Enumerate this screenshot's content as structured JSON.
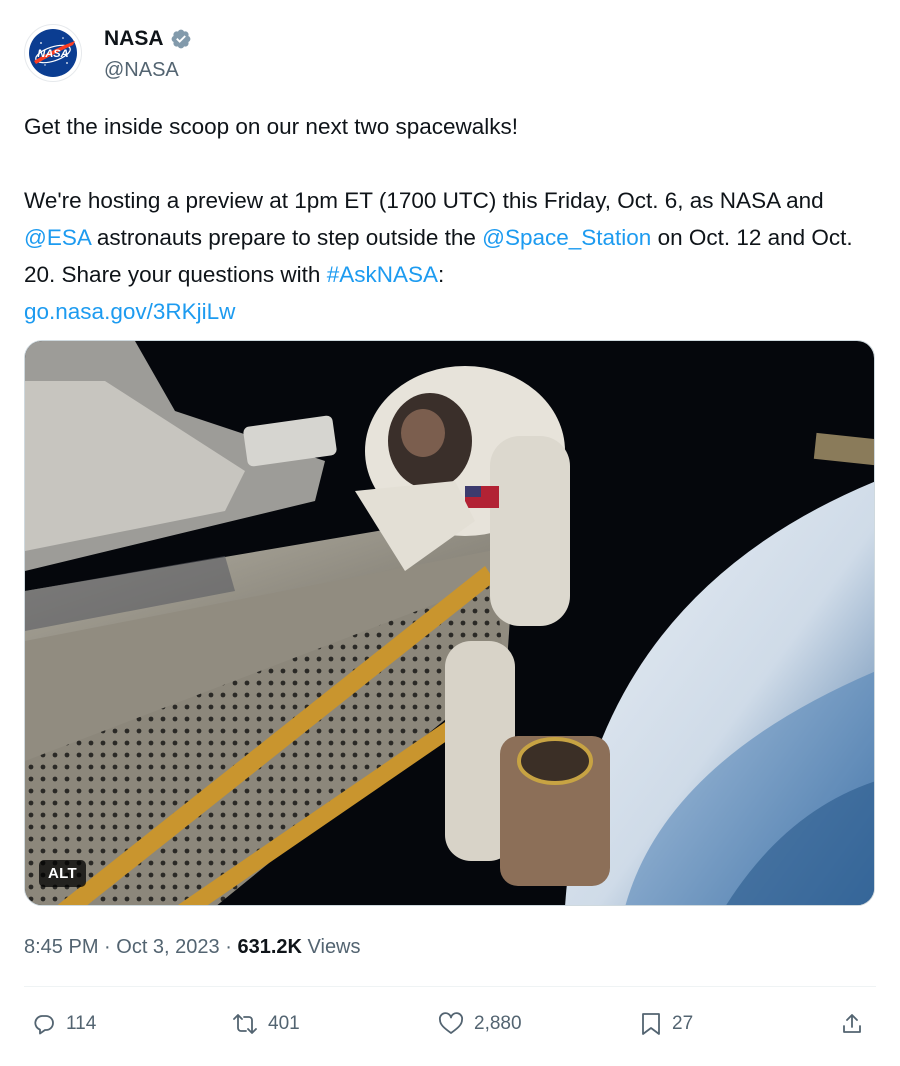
{
  "author": {
    "name": "NASA",
    "handle": "@NASA",
    "avatar_text": "NASA",
    "verified_icon": "verified-badge-icon"
  },
  "tweet": {
    "line1": "Get the inside scoop on our next two spacewalks!",
    "p2_a": "We're hosting a preview at 1pm ET (1700 UTC) this Friday, Oct. 6, as NASA and ",
    "mention_esa": "@ESA",
    "p2_b": " astronauts prepare to step outside the ",
    "mention_station": "@Space_Station",
    "p2_c": " on Oct. 12 and Oct. 20. Share your questions with ",
    "hashtag": "#AskNASA",
    "p2_d": ":",
    "link": "go.nasa.gov/3RKjiLw"
  },
  "media": {
    "alt_label": "ALT"
  },
  "meta": {
    "time": "8:45 PM",
    "date": "Oct 3, 2023",
    "views_count": "631.2K",
    "views_label": "Views"
  },
  "actions": {
    "replies": "114",
    "reposts": "401",
    "likes": "2,880",
    "bookmarks": "27"
  },
  "colors": {
    "link": "#1d9bf0",
    "secondary_text": "#536471",
    "nasa_blue": "#0b3d91",
    "nasa_red": "#fc3d21"
  }
}
